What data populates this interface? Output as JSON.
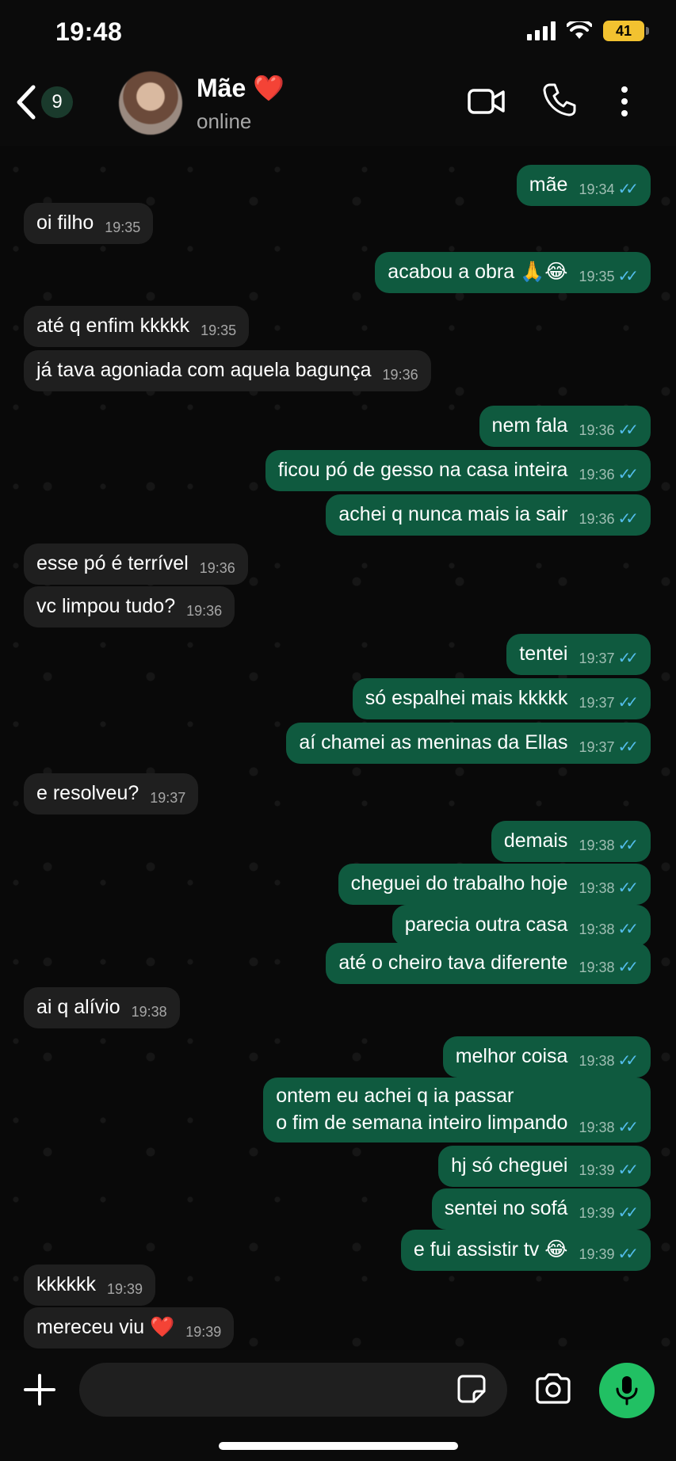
{
  "status_bar": {
    "time": "19:48",
    "battery": "41"
  },
  "header": {
    "back_count": "9",
    "name": "Mãe ❤️",
    "status": "online"
  },
  "messages": [
    {
      "dir": "out",
      "text": "mãe",
      "time": "19:34"
    },
    {
      "dir": "in",
      "text": "oi filho",
      "time": "19:35"
    },
    {
      "dir": "out",
      "text": "acabou a obra 🙏😂",
      "time": "19:35"
    },
    {
      "dir": "in",
      "text": "até q enfim kkkkk",
      "time": "19:35"
    },
    {
      "dir": "in",
      "text": "já tava agoniada com aquela bagunça",
      "time": "19:36"
    },
    {
      "dir": "out",
      "text": "nem fala",
      "time": "19:36"
    },
    {
      "dir": "out",
      "text": "ficou pó de gesso na casa inteira",
      "time": "19:36"
    },
    {
      "dir": "out",
      "text": "achei q nunca mais ia sair",
      "time": "19:36"
    },
    {
      "dir": "in",
      "text": "esse pó é terrível",
      "time": "19:36"
    },
    {
      "dir": "in",
      "text": "vc limpou tudo?",
      "time": "19:36"
    },
    {
      "dir": "out",
      "text": "tentei",
      "time": "19:37"
    },
    {
      "dir": "out",
      "text": "só espalhei mais kkkkk",
      "time": "19:37"
    },
    {
      "dir": "out",
      "text": "aí chamei as meninas da Ellas",
      "time": "19:37"
    },
    {
      "dir": "in",
      "text": "e resolveu?",
      "time": "19:37"
    },
    {
      "dir": "out",
      "text": "demais",
      "time": "19:38"
    },
    {
      "dir": "out",
      "text": "cheguei do trabalho hoje",
      "time": "19:38"
    },
    {
      "dir": "out",
      "text": "parecia outra casa",
      "time": "19:38"
    },
    {
      "dir": "out",
      "text": "até o cheiro tava diferente",
      "time": "19:38"
    },
    {
      "dir": "in",
      "text": "ai q alívio",
      "time": "19:38"
    },
    {
      "dir": "out",
      "text": "melhor coisa",
      "time": "19:38"
    },
    {
      "dir": "out",
      "text": "ontem eu achei q ia passar\no fim de semana inteiro limpando",
      "time": "19:38"
    },
    {
      "dir": "out",
      "text": "hj só cheguei",
      "time": "19:39"
    },
    {
      "dir": "out",
      "text": "sentei no sofá",
      "time": "19:39"
    },
    {
      "dir": "out",
      "text": "e fui assistir tv 😂",
      "time": "19:39"
    },
    {
      "dir": "in",
      "text": "kkkkkk",
      "time": "19:39"
    },
    {
      "dir": "in",
      "text": "mereceu viu ❤️",
      "time": "19:39"
    }
  ],
  "composer": {
    "placeholder": ""
  },
  "colors": {
    "outgoing": "#0f5a3f",
    "incoming": "#1f1f1f",
    "ticks": "#53bdeb",
    "mic": "#21c063",
    "battery": "#f2c230"
  }
}
